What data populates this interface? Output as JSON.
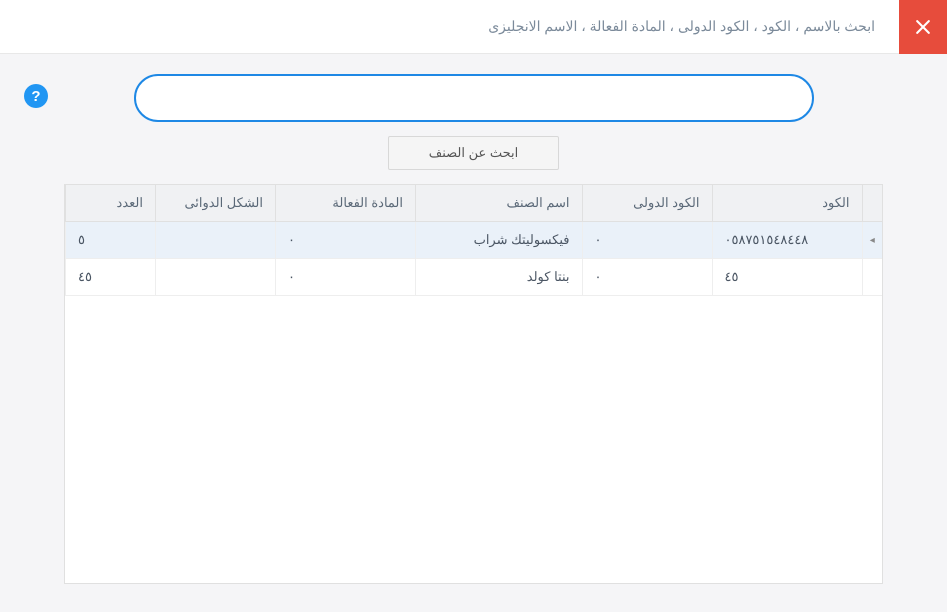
{
  "header": {
    "title": "ابحث بالاسم ، الكود ، الكود الدولى ، المادة الفعالة ، الاسم الانجليزى"
  },
  "help": {
    "symbol": "?"
  },
  "search": {
    "placeholder": "",
    "value": "",
    "button_label": "ابحث عن الصنف"
  },
  "table": {
    "headers": {
      "code": "الكود",
      "intl_code": "الكود الدولى",
      "name": "اسم الصنف",
      "active_ingredient": "المادة الفعالة",
      "pharma_form": "الشكل الدوائى",
      "count": "العدد"
    },
    "rows": [
      {
        "indicator": "◂",
        "selected": true,
        "code": "٠٥٨٧٥١٥٤٨٤٤٨",
        "intl_code": "٠",
        "name": "فيكسوليتك شراب",
        "active_ingredient": "٠",
        "pharma_form": "",
        "count": "٥"
      },
      {
        "indicator": "",
        "selected": false,
        "code": "٤٥",
        "intl_code": "٠",
        "name": "بنتا كولد",
        "active_ingredient": "٠",
        "pharma_form": "",
        "count": "٤٥"
      }
    ]
  }
}
